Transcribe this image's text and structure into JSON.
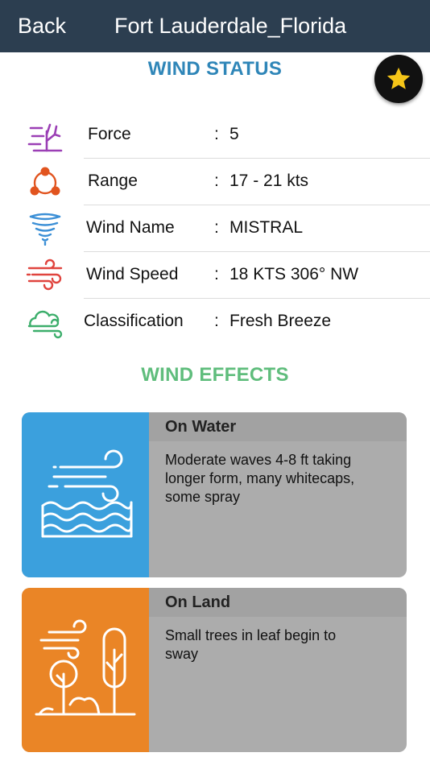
{
  "nav": {
    "back_label": "Back",
    "title": "Fort Lauderdale_Florida"
  },
  "status": {
    "title": "WIND STATUS",
    "rows": [
      {
        "label": "Force",
        "value": "5",
        "icon": "tree-wind-icon"
      },
      {
        "label": "Range",
        "value": "17 - 21  kts",
        "icon": "range-cycle-icon"
      },
      {
        "label": "Wind Name",
        "value": "MISTRAL",
        "icon": "tornado-icon"
      },
      {
        "label": "Wind Speed",
        "value": "18 KTS 306° NW",
        "icon": "wind-speed-icon"
      },
      {
        "label": "Classification",
        "value": "Fresh Breeze",
        "icon": "cloud-wind-icon"
      }
    ],
    "colon": ":"
  },
  "effects": {
    "title": "WIND EFFECTS",
    "water": {
      "heading": "On Water",
      "text": "Moderate waves 4-8 ft taking longer form, many whitecaps, some spray"
    },
    "land": {
      "heading": "On Land",
      "text": "Small trees in leaf begin to sway"
    }
  },
  "colors": {
    "navbar": "#2c3e50",
    "status_title": "#2f86b8",
    "effects_title": "#5fbd7c",
    "water_card": "#3ba0dd",
    "land_card": "#ea8526",
    "favorite_star": "#f5c518"
  }
}
